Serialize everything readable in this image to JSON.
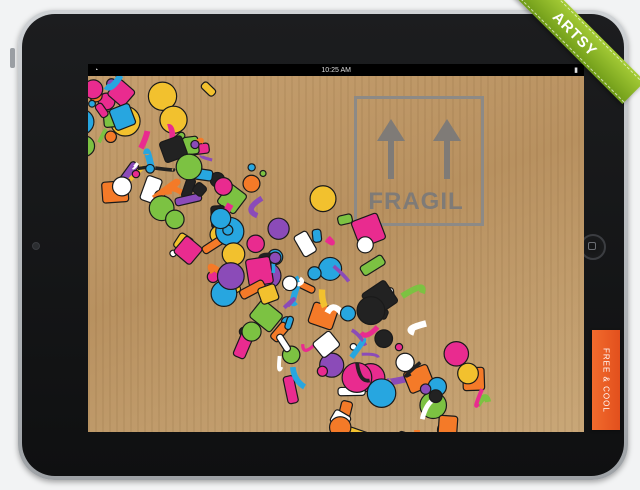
{
  "device": {
    "type": "tablet",
    "orientation": "landscape"
  },
  "status_bar": {
    "time": "10:25 AM"
  },
  "artwork": {
    "background": "cardboard",
    "stamp_text": "FRAGIL",
    "doodle_colors": [
      "#e92b8f",
      "#27a6e0",
      "#f2c12e",
      "#7cc242",
      "#8b4bb8",
      "#f47a28",
      "#ffffff",
      "#222222"
    ]
  },
  "ribbon": {
    "label": "ARTSY",
    "color": "#8cb82a"
  },
  "side_tab": {
    "label": "FREE & COOL",
    "color": "#ee5a24"
  }
}
